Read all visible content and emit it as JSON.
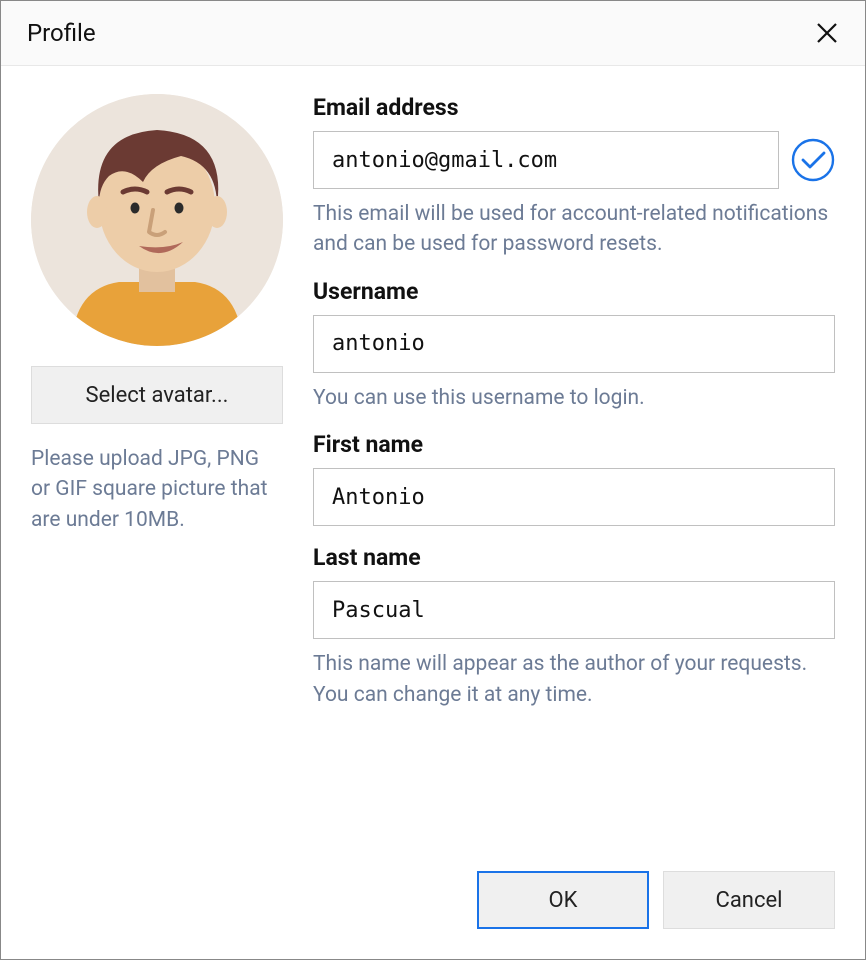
{
  "dialog": {
    "title": "Profile"
  },
  "avatar": {
    "select_button": "Select avatar...",
    "hint": "Please upload JPG, PNG or GIF square picture that are under 10MB."
  },
  "fields": {
    "email": {
      "label": "Email address",
      "value": "antonio@gmail.com",
      "hint": "This email will be used for account-related notifications and can be used for password resets."
    },
    "username": {
      "label": "Username",
      "value": "antonio",
      "hint": "You can use this username to login."
    },
    "firstname": {
      "label": "First name",
      "value": "Antonio"
    },
    "lastname": {
      "label": "Last name",
      "value": "Pascual",
      "hint": "This name will appear as the author of your requests. You can change it at any time."
    }
  },
  "footer": {
    "ok": "OK",
    "cancel": "Cancel"
  }
}
